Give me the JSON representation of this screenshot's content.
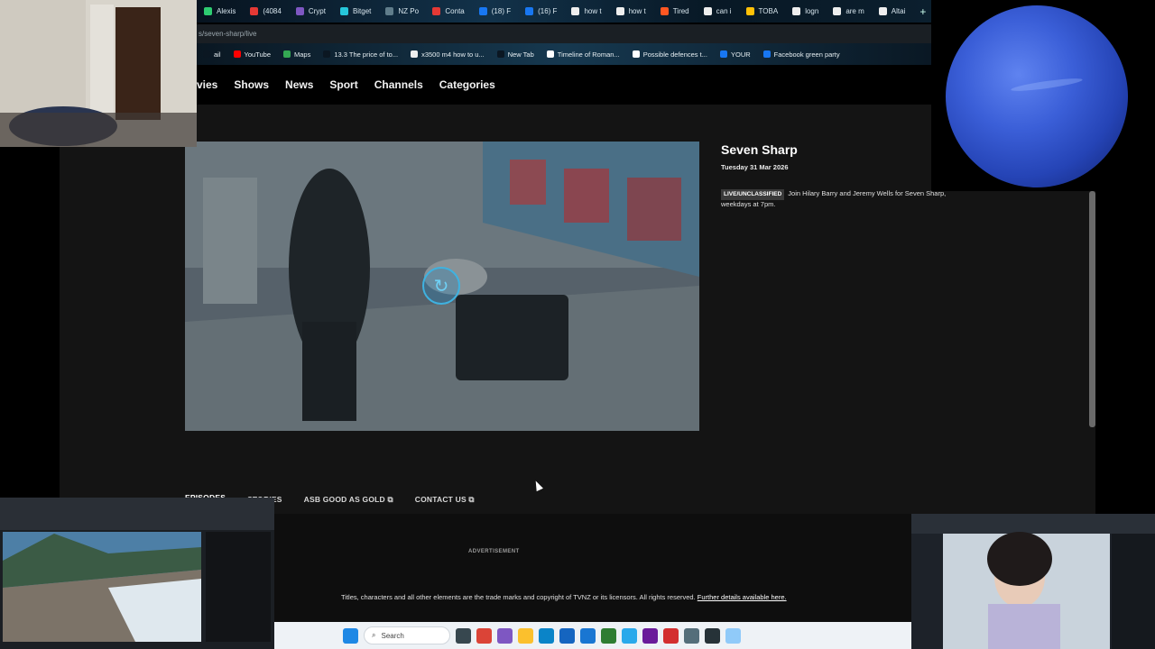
{
  "browser": {
    "tabs": [
      {
        "label": "Alexis",
        "color": "#2ecc71"
      },
      {
        "label": "(4084",
        "color": "#e53935"
      },
      {
        "label": "Crypt",
        "color": "#7e57c2"
      },
      {
        "label": "Bitget",
        "color": "#26c6da"
      },
      {
        "label": "NZ Po",
        "color": "#607d8b"
      },
      {
        "label": "Conta",
        "color": "#e53935"
      },
      {
        "label": "(18) F",
        "color": "#1877f2"
      },
      {
        "label": "(16) F",
        "color": "#1877f2"
      },
      {
        "label": "how t",
        "color": "#eeeeee"
      },
      {
        "label": "how t",
        "color": "#eeeeee"
      },
      {
        "label": "Tired",
        "color": "#ff5722"
      },
      {
        "label": "can i",
        "color": "#eeeeee"
      },
      {
        "label": "TOBA",
        "color": "#ffc107"
      },
      {
        "label": "logn",
        "color": "#eeeeee"
      },
      {
        "label": "are m",
        "color": "#eeeeee"
      },
      {
        "label": "Altai",
        "color": "#eeeeee"
      }
    ],
    "new_tab_symbol": "+",
    "url": "s/seven-sharp/live",
    "bookmarks": [
      {
        "label": "ail",
        "color": "#0b1722"
      },
      {
        "label": "YouTube",
        "color": "#ff0000"
      },
      {
        "label": "Maps",
        "color": "#34a853"
      },
      {
        "label": "13.3 The price of to...",
        "color": "#0b1722"
      },
      {
        "label": "x3500 m4 how to u...",
        "color": "#eeeeee"
      },
      {
        "label": "New Tab",
        "color": "#0b1722"
      },
      {
        "label": "Timeline of Roman...",
        "color": "#ffffff"
      },
      {
        "label": "Possible defences t...",
        "color": "#ffffff"
      },
      {
        "label": "YOUR",
        "color": "#1877f2"
      },
      {
        "label": "Facebook green party",
        "color": "#1877f2"
      }
    ]
  },
  "site": {
    "nav": [
      "vies",
      "Shows",
      "News",
      "Sport",
      "Channels",
      "Categories"
    ],
    "show": {
      "title": "Seven Sharp",
      "date": "Tuesday 31 Mar 2026",
      "badge": "LIVE/UNCLASSIFIED",
      "description": "Join Hilary Barry and Jeremy Wells for Seven Sharp, weekdays at 7pm."
    },
    "subtabs": [
      "EPISODES",
      "STORIES",
      "ASB GOOD AS GOLD",
      "CONTACT US"
    ],
    "external_symbol": "⧉",
    "advertisement": "ADVERTISEMENT",
    "copyright": "Titles, characters and all other elements are the trade marks and copyright of TVNZ or its licensors. All rights reserved.",
    "copyright_link": "Further details available here."
  },
  "taskbar": {
    "search_placeholder": "Search",
    "apps": [
      {
        "name": "start",
        "color": "#1e88e5"
      },
      {
        "name": "task-view",
        "color": "#37474f"
      },
      {
        "name": "chrome",
        "color": "#db4437"
      },
      {
        "name": "photos",
        "color": "#7e57c2"
      },
      {
        "name": "files",
        "color": "#fbc02d"
      },
      {
        "name": "edge",
        "color": "#0a84c8"
      },
      {
        "name": "mail",
        "color": "#1565c0"
      },
      {
        "name": "store",
        "color": "#1976d2"
      },
      {
        "name": "app-green",
        "color": "#2e7d32"
      },
      {
        "name": "telegram",
        "color": "#29a9eb"
      },
      {
        "name": "app-purple",
        "color": "#6a1b9a"
      },
      {
        "name": "app-red",
        "color": "#d32f2f"
      },
      {
        "name": "settings",
        "color": "#546e7a"
      },
      {
        "name": "app-dark",
        "color": "#263238"
      },
      {
        "name": "app-light",
        "color": "#90caf9"
      }
    ]
  }
}
